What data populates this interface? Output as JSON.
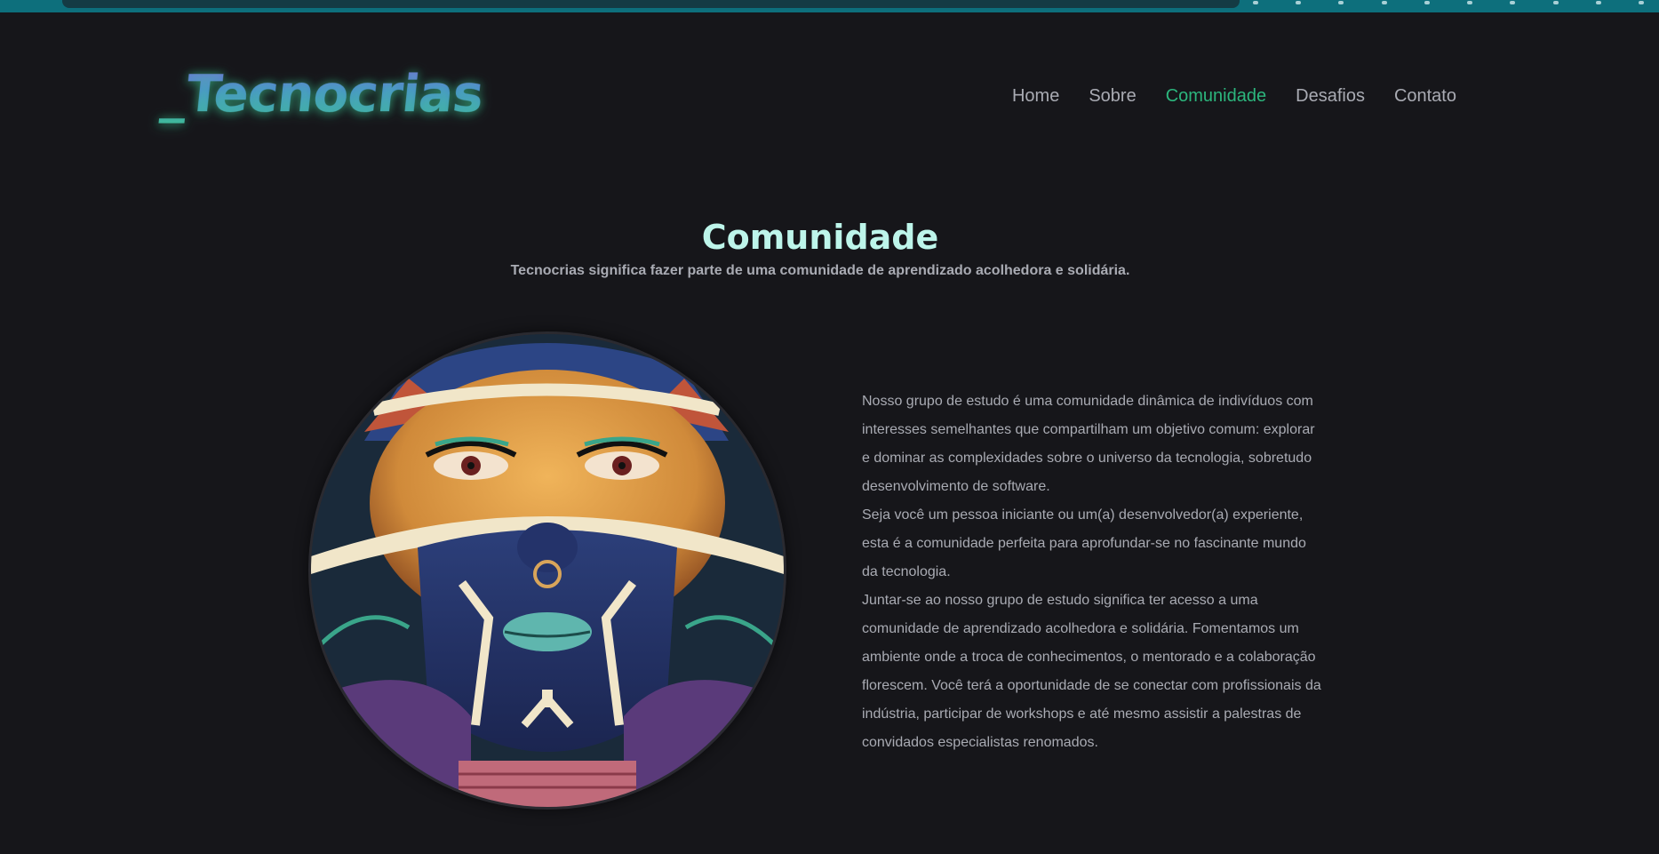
{
  "brand": {
    "logo_text": "_Tecnocrias",
    "colors": {
      "background": "#16161a",
      "accent": "#2cb67d",
      "title": "#bdf5ea",
      "text": "#a9abb3",
      "browser_bar": "#0d6f7c"
    }
  },
  "nav": {
    "items": [
      {
        "label": "Home",
        "active": false
      },
      {
        "label": "Sobre",
        "active": false
      },
      {
        "label": "Comunidade",
        "active": true
      },
      {
        "label": "Desafios",
        "active": false
      },
      {
        "label": "Contato",
        "active": false
      }
    ]
  },
  "section": {
    "title": "Comunidade",
    "subtitle": "Tecnocrias significa fazer parte de uma comunidade de aprendizado acolhedora e solidária.",
    "paragraphs": [
      "Nosso grupo de estudo é uma comunidade dinâmica de indivíduos com interesses semelhantes que compartilham um objetivo comum: explorar e dominar as complexidades sobre o universo da tecnologia, sobretudo desenvolvimento de software.",
      "Seja você um pessoa iniciante ou um(a) desenvolvedor(a) experiente, esta é a comunidade perfeita para aprofundar-se no fascinante mundo da tecnologia.",
      "Juntar-se ao nosso grupo de estudo significa ter acesso a uma comunidade de aprendizado acolhedora e solidária. Fomentamos um ambiente onde a troca de conhecimentos, o mentorado e a colaboração florescem. Você terá a oportunidade de se conectar com profissionais da indústria, participar de workshops e até mesmo assistir a palestras de convidados especialistas renomados."
    ],
    "image": {
      "icon": "portrait-illustration"
    }
  }
}
